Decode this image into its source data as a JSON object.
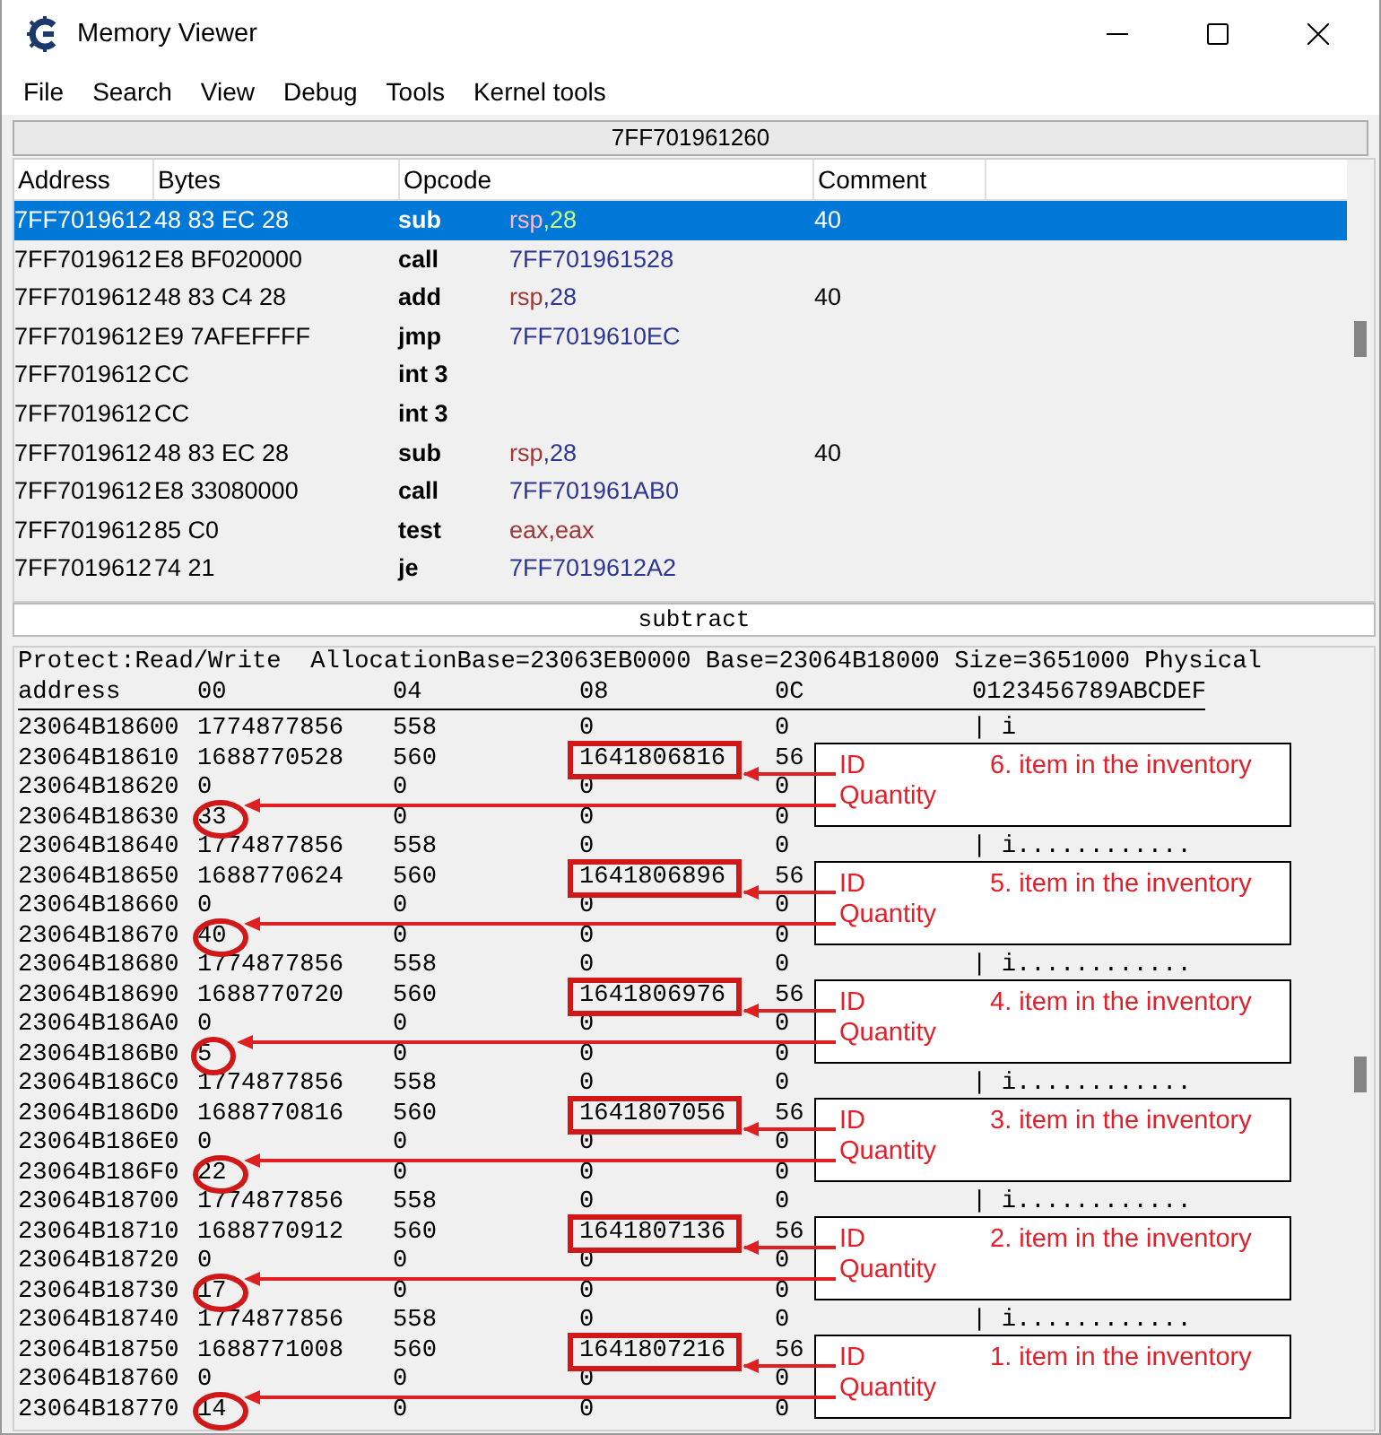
{
  "window": {
    "title": "Memory Viewer"
  },
  "menu": [
    "File",
    "Search",
    "View",
    "Debug",
    "Tools",
    "Kernel tools"
  ],
  "address_bar": {
    "value": "7FF701961260"
  },
  "disassembly": {
    "columns": [
      "Address",
      "Bytes",
      "Opcode",
      "Comment"
    ],
    "rows": [
      {
        "address": "7FF7019612",
        "bytes": "48 83 EC 28",
        "opcode": "sub",
        "params": [
          {
            "text": "rsp",
            "kind": "register"
          },
          {
            "text": ",28",
            "kind": "number"
          }
        ],
        "comment": "40",
        "selected": true
      },
      {
        "address": "7FF7019612",
        "bytes": "E8 BF020000",
        "opcode": "call",
        "params": [
          {
            "text": "7FF701961528",
            "kind": "number"
          }
        ],
        "selected": false
      },
      {
        "address": "7FF7019612",
        "bytes": "48 83 C4 28",
        "opcode": "add",
        "params": [
          {
            "text": "rsp",
            "kind": "register"
          },
          {
            "text": ",28",
            "kind": "number"
          }
        ],
        "comment": "40",
        "selected": false
      },
      {
        "address": "7FF7019612",
        "bytes": "E9 7AFEFFFF",
        "opcode": "jmp",
        "params": [
          {
            "text": "7FF7019610EC",
            "kind": "number"
          }
        ],
        "selected": false
      },
      {
        "address": "7FF7019612",
        "bytes": "CC",
        "opcode": "int 3",
        "params": [],
        "selected": false
      },
      {
        "address": "7FF7019612",
        "bytes": "CC",
        "opcode": "int 3",
        "params": [],
        "selected": false
      },
      {
        "address": "7FF7019612",
        "bytes": "48 83 EC 28",
        "opcode": "sub",
        "params": [
          {
            "text": "rsp",
            "kind": "register"
          },
          {
            "text": ",28",
            "kind": "number"
          }
        ],
        "comment": "40",
        "selected": false
      },
      {
        "address": "7FF7019612",
        "bytes": "E8 33080000",
        "opcode": "call",
        "params": [
          {
            "text": "7FF701961AB0",
            "kind": "number"
          }
        ],
        "selected": false
      },
      {
        "address": "7FF7019612",
        "bytes": "85 C0",
        "opcode": "test",
        "params": [
          {
            "text": "eax,eax",
            "kind": "register"
          }
        ],
        "selected": false
      },
      {
        "address": "7FF7019612",
        "bytes": "74 21",
        "opcode": "je",
        "params": [
          {
            "text": "7FF7019612A2",
            "kind": "number"
          }
        ],
        "selected": false
      }
    ]
  },
  "instruction_description": "subtract",
  "hex_view": {
    "info": "Protect:Read/Write  AllocationBase=23063EB0000 Base=23064B18000 Size=3651000 Physical",
    "columns": [
      "address",
      "00",
      "04",
      "08",
      "0C",
      "0123456789ABCDEF"
    ],
    "rows": [
      {
        "address": "23064B18600",
        "values": [
          "1774877856",
          "558",
          "0",
          "0"
        ],
        "ascii": "| i",
        "boxed": false,
        "circled": false
      },
      {
        "address": "23064B18610",
        "values": [
          "1688770528",
          "560",
          "1641806816",
          "56"
        ],
        "boxed": true,
        "circled": false
      },
      {
        "address": "23064B18620",
        "values": [
          "0",
          "0",
          "0",
          "0"
        ],
        "boxed": false,
        "circled": false
      },
      {
        "address": "23064B18630",
        "values": [
          "33",
          "0",
          "0",
          "0"
        ],
        "boxed": false,
        "circled": true
      },
      {
        "address": "23064B18640",
        "values": [
          "1774877856",
          "558",
          "0",
          "0"
        ],
        "ascii": "| i............",
        "boxed": false,
        "circled": false
      },
      {
        "address": "23064B18650",
        "values": [
          "1688770624",
          "560",
          "1641806896",
          "56"
        ],
        "boxed": true,
        "circled": false
      },
      {
        "address": "23064B18660",
        "values": [
          "0",
          "0",
          "0",
          "0"
        ],
        "boxed": false,
        "circled": false
      },
      {
        "address": "23064B18670",
        "values": [
          "40",
          "0",
          "0",
          "0"
        ],
        "boxed": false,
        "circled": true
      },
      {
        "address": "23064B18680",
        "values": [
          "1774877856",
          "558",
          "0",
          "0"
        ],
        "ascii": "| i............",
        "boxed": false,
        "circled": false
      },
      {
        "address": "23064B18690",
        "values": [
          "1688770720",
          "560",
          "1641806976",
          "56"
        ],
        "boxed": true,
        "circled": false
      },
      {
        "address": "23064B186A0",
        "values": [
          "0",
          "0",
          "0",
          "0"
        ],
        "boxed": false,
        "circled": false
      },
      {
        "address": "23064B186B0",
        "values": [
          "5",
          "0",
          "0",
          "0"
        ],
        "boxed": false,
        "circled": true
      },
      {
        "address": "23064B186C0",
        "values": [
          "1774877856",
          "558",
          "0",
          "0"
        ],
        "ascii": "| i............",
        "boxed": false,
        "circled": false
      },
      {
        "address": "23064B186D0",
        "values": [
          "1688770816",
          "560",
          "1641807056",
          "56"
        ],
        "boxed": true,
        "circled": false
      },
      {
        "address": "23064B186E0",
        "values": [
          "0",
          "0",
          "0",
          "0"
        ],
        "boxed": false,
        "circled": false
      },
      {
        "address": "23064B186F0",
        "values": [
          "22",
          "0",
          "0",
          "0"
        ],
        "boxed": false,
        "circled": true
      },
      {
        "address": "23064B18700",
        "values": [
          "1774877856",
          "558",
          "0",
          "0"
        ],
        "ascii": "| i............",
        "boxed": false,
        "circled": false
      },
      {
        "address": "23064B18710",
        "values": [
          "1688770912",
          "560",
          "1641807136",
          "56"
        ],
        "boxed": true,
        "circled": false
      },
      {
        "address": "23064B18720",
        "values": [
          "0",
          "0",
          "0",
          "0"
        ],
        "boxed": false,
        "circled": false
      },
      {
        "address": "23064B18730",
        "values": [
          "17",
          "0",
          "0",
          "0"
        ],
        "boxed": false,
        "circled": true
      },
      {
        "address": "23064B18740",
        "values": [
          "1774877856",
          "558",
          "0",
          "0"
        ],
        "ascii": "| i............",
        "boxed": false,
        "circled": false
      },
      {
        "address": "23064B18750",
        "values": [
          "1688771008",
          "560",
          "1641807216",
          "56"
        ],
        "boxed": true,
        "circled": false
      },
      {
        "address": "23064B18760",
        "values": [
          "0",
          "0",
          "0",
          "0"
        ],
        "boxed": false,
        "circled": false
      },
      {
        "address": "23064B18770",
        "values": [
          "14",
          "0",
          "0",
          "0"
        ],
        "boxed": false,
        "circled": true
      }
    ]
  },
  "annotations": [
    {
      "id_label": "ID",
      "quantity_label": "Quantity",
      "title": "6. item in the inventory"
    },
    {
      "id_label": "ID",
      "quantity_label": "Quantity",
      "title": "5. item in the inventory"
    },
    {
      "id_label": "ID",
      "quantity_label": "Quantity",
      "title": "4. item in the inventory"
    },
    {
      "id_label": "ID",
      "quantity_label": "Quantity",
      "title": "3. item in the inventory"
    },
    {
      "id_label": "ID",
      "quantity_label": "Quantity",
      "title": "2. item in the inventory"
    },
    {
      "id_label": "ID",
      "quantity_label": "Quantity",
      "title": "1. item in the inventory"
    }
  ]
}
